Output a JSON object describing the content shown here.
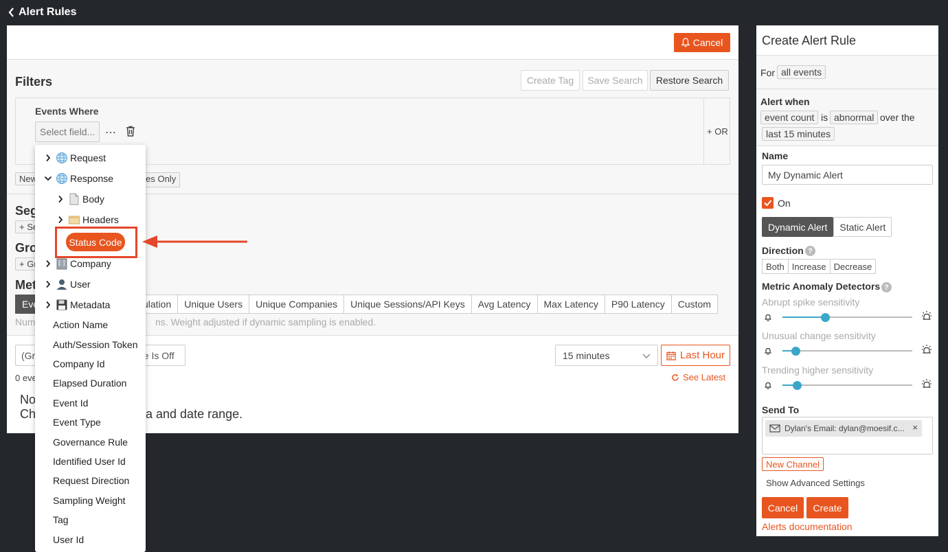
{
  "nav": {
    "back_label": "Alert Rules"
  },
  "main": {
    "cancel_label": "Cancel",
    "filters": {
      "title": "Filters",
      "create_tag_label": "Create Tag",
      "save_search_label": "Save Search",
      "restore_search_label": "Restore Search",
      "events_where_label": "Events Where",
      "select_field_placeholder": "Select field...",
      "or_label": "+ OR",
      "chip_new_partial": "New",
      "chip_companies_only_partial": "nies Only"
    },
    "segments_partial": "Seg",
    "segments_add_partial": "+ Se",
    "group_partial": "Gro",
    "group_add_partial": "+ Gr",
    "metric_partial": "Met",
    "metric_tabs": [
      {
        "label": "Eve",
        "active": true
      },
      {
        "label": "ulation",
        "active": false
      },
      {
        "label": "Unique Users",
        "active": false
      },
      {
        "label": "Unique Companies",
        "active": false
      },
      {
        "label": "Unique Sessions/API Keys",
        "active": false
      },
      {
        "label": "Avg Latency",
        "active": false
      },
      {
        "label": "Max Latency",
        "active": false
      },
      {
        "label": "P90 Latency",
        "active": false
      },
      {
        "label": "Custom",
        "active": false
      }
    ],
    "metric_note_left": "Num",
    "metric_note_right": "ns. Weight adjusted if dynamic sampling is enabled.",
    "group_select_partial": "(Gr",
    "sampling_partial": "ge Is Off",
    "time_window_value": "15 minutes",
    "last_hour_label": "Last Hour",
    "see_latest_label": "See Latest",
    "events_count_partial": "0 eve",
    "no_data_partial_1": "No",
    "no_data_partial_2": "Ch",
    "no_data_tail": "a and date range."
  },
  "dropdown": {
    "items": [
      {
        "label": "Request",
        "type": "group",
        "expanded": false,
        "icon": "globe-icon"
      },
      {
        "label": "Response",
        "type": "group",
        "expanded": true,
        "icon": "globe-icon"
      },
      {
        "label": "Body",
        "type": "subgroup",
        "expanded": false,
        "icon": "document-icon"
      },
      {
        "label": "Headers",
        "type": "subgroup",
        "expanded": false,
        "icon": "folder-icon"
      },
      {
        "label": "Status Code",
        "type": "highlighted"
      },
      {
        "label": "Company",
        "type": "group",
        "expanded": false,
        "icon": "building-icon"
      },
      {
        "label": "User",
        "type": "group",
        "expanded": false,
        "icon": "user-icon"
      },
      {
        "label": "Metadata",
        "type": "group",
        "expanded": false,
        "icon": "floppy-disk-icon"
      },
      {
        "label": "Action Name",
        "type": "field"
      },
      {
        "label": "Auth/Session Token",
        "type": "field"
      },
      {
        "label": "Company Id",
        "type": "field"
      },
      {
        "label": "Elapsed Duration",
        "type": "field"
      },
      {
        "label": "Event Id",
        "type": "field"
      },
      {
        "label": "Event Type",
        "type": "field"
      },
      {
        "label": "Governance Rule",
        "type": "field"
      },
      {
        "label": "Identified User Id",
        "type": "field"
      },
      {
        "label": "Request Direction",
        "type": "field"
      },
      {
        "label": "Sampling Weight",
        "type": "field"
      },
      {
        "label": "Tag",
        "type": "field"
      },
      {
        "label": "User Id",
        "type": "field"
      }
    ]
  },
  "alert_rule": {
    "title": "Create Alert Rule",
    "for_label": "For",
    "for_value": "all events",
    "alert_when_label": "Alert when",
    "metric_value": "event count",
    "is_label": "is",
    "condition_value": "abnormal",
    "over_the_label": "over the",
    "window_value": "last 15 minutes",
    "name_label": "Name",
    "name_value": "My Dynamic Alert",
    "on_label": "On",
    "on_checked": true,
    "dynamic_alert_label": "Dynamic Alert",
    "static_alert_label": "Static Alert",
    "direction_label": "Direction",
    "direction_options": [
      "Both",
      "Increase",
      "Decrease"
    ],
    "detectors_label": "Metric Anomaly Detectors",
    "sliders": [
      {
        "label": "Abrupt spike sensitivity",
        "value": 0.33
      },
      {
        "label": "Unusual change sensitivity",
        "value": 0.1
      },
      {
        "label": "Trending higher sensitivity",
        "value": 0.11
      }
    ],
    "send_to_label": "Send To",
    "channel_chip": "Dylan's Email: dylan@moesif.c...",
    "new_channel_label": "New Channel",
    "advanced_label": "Show Advanced Settings",
    "cancel_label": "Cancel",
    "create_label": "Create",
    "docs_label": "Alerts documentation"
  },
  "colors": {
    "accent": "#e8551f",
    "background": "#24282d",
    "slider": "#3aa7c9",
    "annotation": "#e4472a"
  }
}
